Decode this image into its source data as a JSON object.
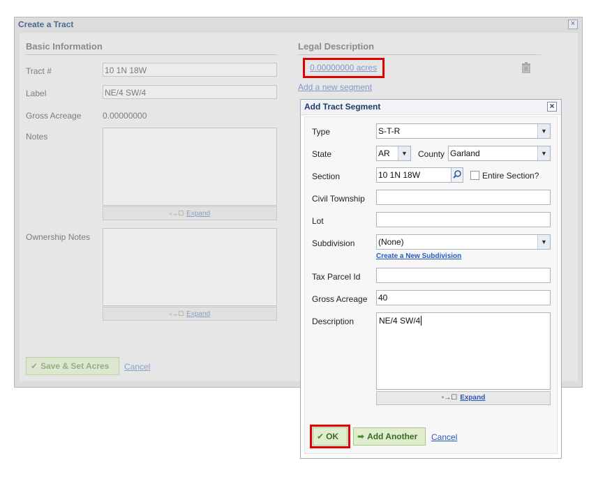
{
  "window": {
    "title": "Create a Tract",
    "close_glyph": "×"
  },
  "basic": {
    "heading": "Basic Information",
    "tract_label": "Tract #",
    "tract_value": "10 1N 18W",
    "label_label": "Label",
    "label_value": "NE/4 SW/4",
    "gross_label": "Gross Acreage",
    "gross_value": "0.00000000",
    "notes_label": "Notes",
    "ownership_label": "Ownership Notes",
    "expand_label": "Expand"
  },
  "legal": {
    "heading": "Legal Description",
    "acres_link": "0.00000000 acres",
    "add_segment_link": "Add a new segment"
  },
  "bg_actions": {
    "save_label": "Save & Set Acres",
    "cancel_label": "Cancel"
  },
  "segment_dialog": {
    "title": "Add Tract Segment",
    "close_glyph": "×",
    "type_label": "Type",
    "type_value": "S-T-R",
    "state_label": "State",
    "state_value": "AR",
    "county_label": "County",
    "county_value": "Garland",
    "section_label": "Section",
    "section_value": "10 1N 18W",
    "entire_section_label": "Entire Section?",
    "civil_township_label": "Civil Township",
    "civil_township_value": "",
    "lot_label": "Lot",
    "lot_value": "",
    "subdivision_label": "Subdivision",
    "subdivision_value": "(None)",
    "create_subdivision_link": "Create a New Subdivision",
    "tax_parcel_label": "Tax Parcel Id",
    "tax_parcel_value": "",
    "gross_acreage_label": "Gross Acreage",
    "gross_acreage_value": "40",
    "description_label": "Description",
    "description_value": "NE/4 SW/4",
    "expand_label": "Expand",
    "ok_label": "OK",
    "add_another_label": "Add Another",
    "cancel_label": "Cancel"
  },
  "colors": {
    "highlight": "#e00000",
    "link": "#2858b8",
    "button_green": "#e0eecf"
  },
  "icons": [
    "trash-icon",
    "search-icon",
    "checkmark-icon",
    "arrow-right-icon",
    "expand-icon",
    "chevron-down-icon",
    "close-icon"
  ]
}
